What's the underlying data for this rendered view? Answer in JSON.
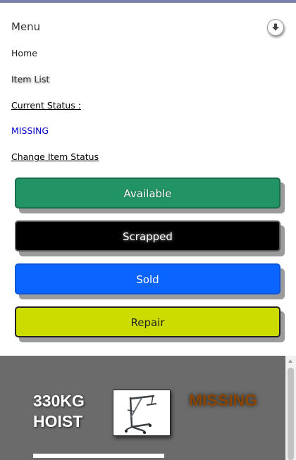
{
  "menu": {
    "title": "Menu",
    "download_icon": "download-arrow-icon"
  },
  "nav": {
    "home": "Home",
    "item_list": "Item List"
  },
  "status": {
    "current_label": "Current Status :",
    "current_value": "MISSING",
    "change_label": "Change Item Status"
  },
  "buttons": {
    "available": "Available",
    "scrapped": "Scrapped",
    "sold": "Sold",
    "repair": "Repair"
  },
  "item": {
    "name": "330KG HOIST",
    "status": "MISSING"
  },
  "colors": {
    "available": "#229365",
    "scrapped": "#000000",
    "sold": "#0a64ff",
    "repair": "#cddc00",
    "status_link": "#0000cc",
    "panel": "#6b6b6b",
    "item_status": "#8a4500"
  }
}
